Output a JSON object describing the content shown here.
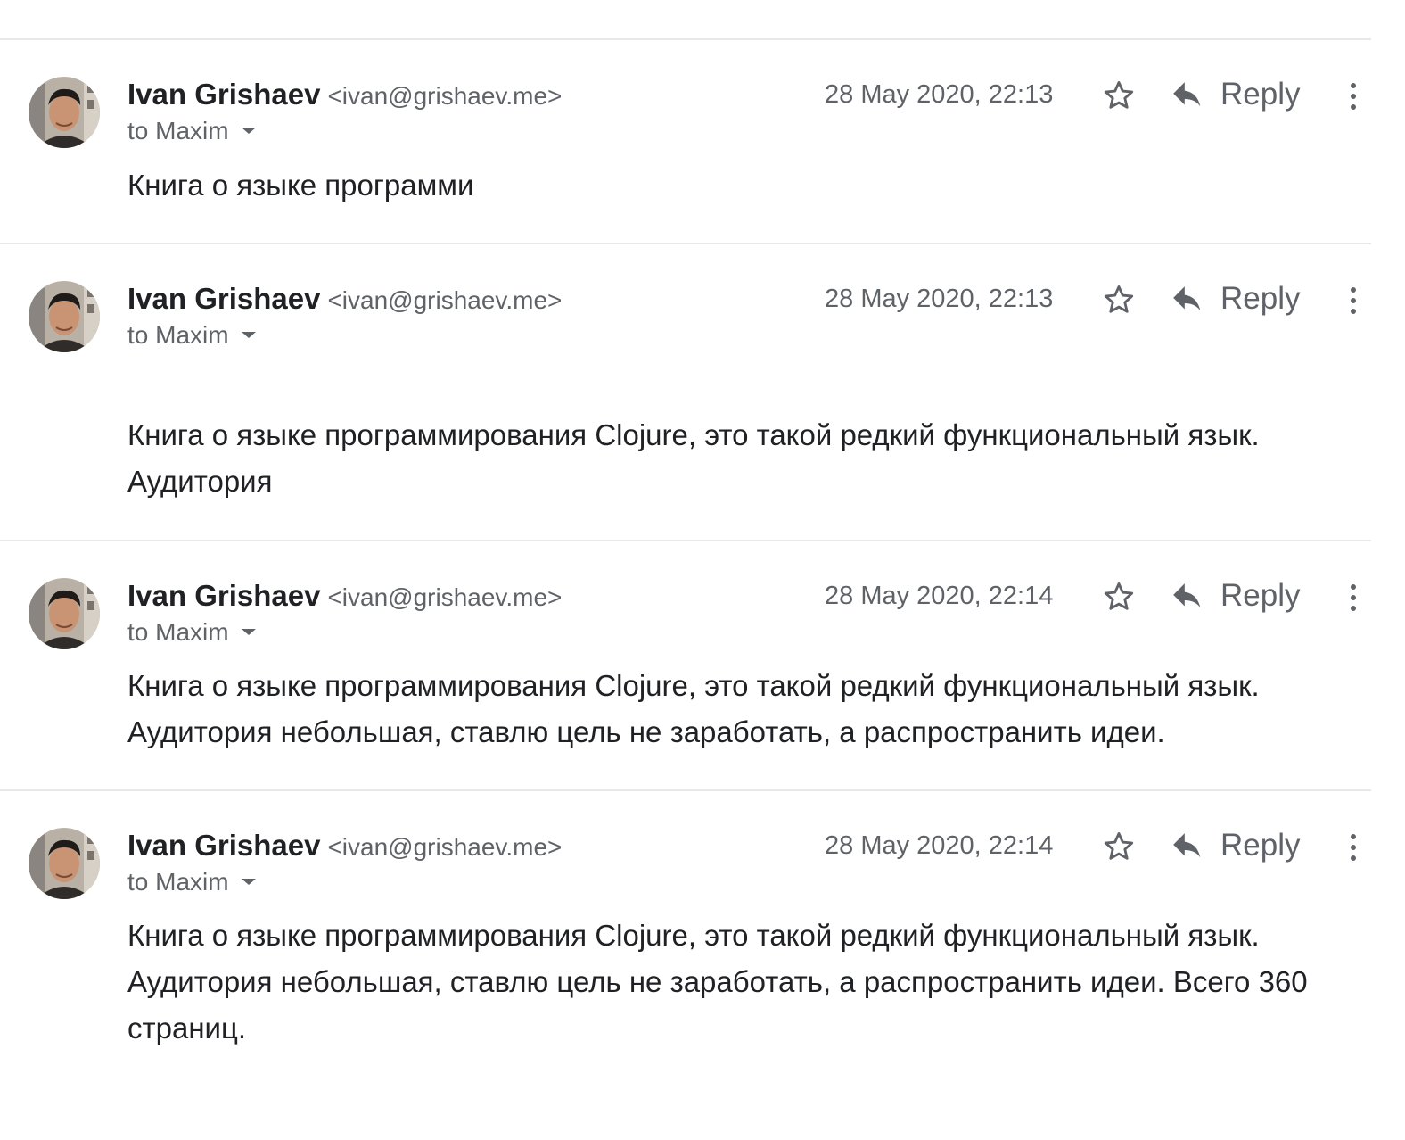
{
  "thread": {
    "messages": [
      {
        "sender_name": "Ivan Grishaev",
        "sender_email": "<ivan@grishaev.me>",
        "recipient": "to Maxim",
        "date": "28 May 2020, 22:13",
        "reply_label": "Reply",
        "body": "Книга о языке программи",
        "starred": false
      },
      {
        "sender_name": "Ivan Grishaev",
        "sender_email": "<ivan@grishaev.me>",
        "recipient": "to Maxim",
        "date": "28 May 2020, 22:13",
        "reply_label": "Reply",
        "body": "Книга о языке программирования Clojure, это такой редкий функциональный язык. Аудитория",
        "starred": false
      },
      {
        "sender_name": "Ivan Grishaev",
        "sender_email": "<ivan@grishaev.me>",
        "recipient": "to Maxim",
        "date": "28 May 2020, 22:14",
        "reply_label": "Reply",
        "body": "Книга о языке программирования Clojure, это такой редкий функциональный язык. Аудитория небольшая, ставлю цель не заработать, а распространить идеи.",
        "starred": false
      },
      {
        "sender_name": "Ivan Grishaev",
        "sender_email": "<ivan@grishaev.me>",
        "recipient": "to Maxim",
        "date": "28 May 2020, 22:14",
        "reply_label": "Reply",
        "body": "Книга о языке программирования Clojure, это такой редкий функциональный язык. Аудитория небольшая, ставлю цель не заработать, а распространить идеи. Всего 360 страниц.",
        "starred": false
      }
    ]
  },
  "icons": {
    "star": "star-outline-icon",
    "reply": "reply-arrow-icon",
    "more": "vertical-dots-icon",
    "caret": "caret-down-icon",
    "avatar": "sender-avatar"
  },
  "colors": {
    "text_primary": "#202124",
    "text_secondary": "#5f6368",
    "divider": "#e8e8e8"
  }
}
